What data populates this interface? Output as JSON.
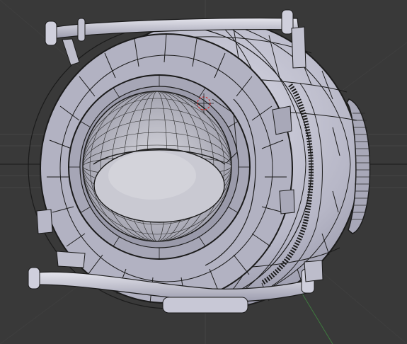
{
  "viewport": {
    "background_color": "#393939",
    "grid_color": "#4a4a4a",
    "axis_x_color": "#8a3a3a",
    "axis_y_color": "#3f7a3f",
    "mesh_fill_color": "#b4b4c4",
    "mesh_shadow_color": "#8e8ea0",
    "mesh_highlight_color": "#d2d2de",
    "wire_color": "#1b1b1b",
    "eye_fill_color": "#c8c8d0",
    "cursor_color": "#d03030",
    "object_icon": "3d-mesh-icon",
    "cursor_icon": "3d-cursor-icon"
  }
}
